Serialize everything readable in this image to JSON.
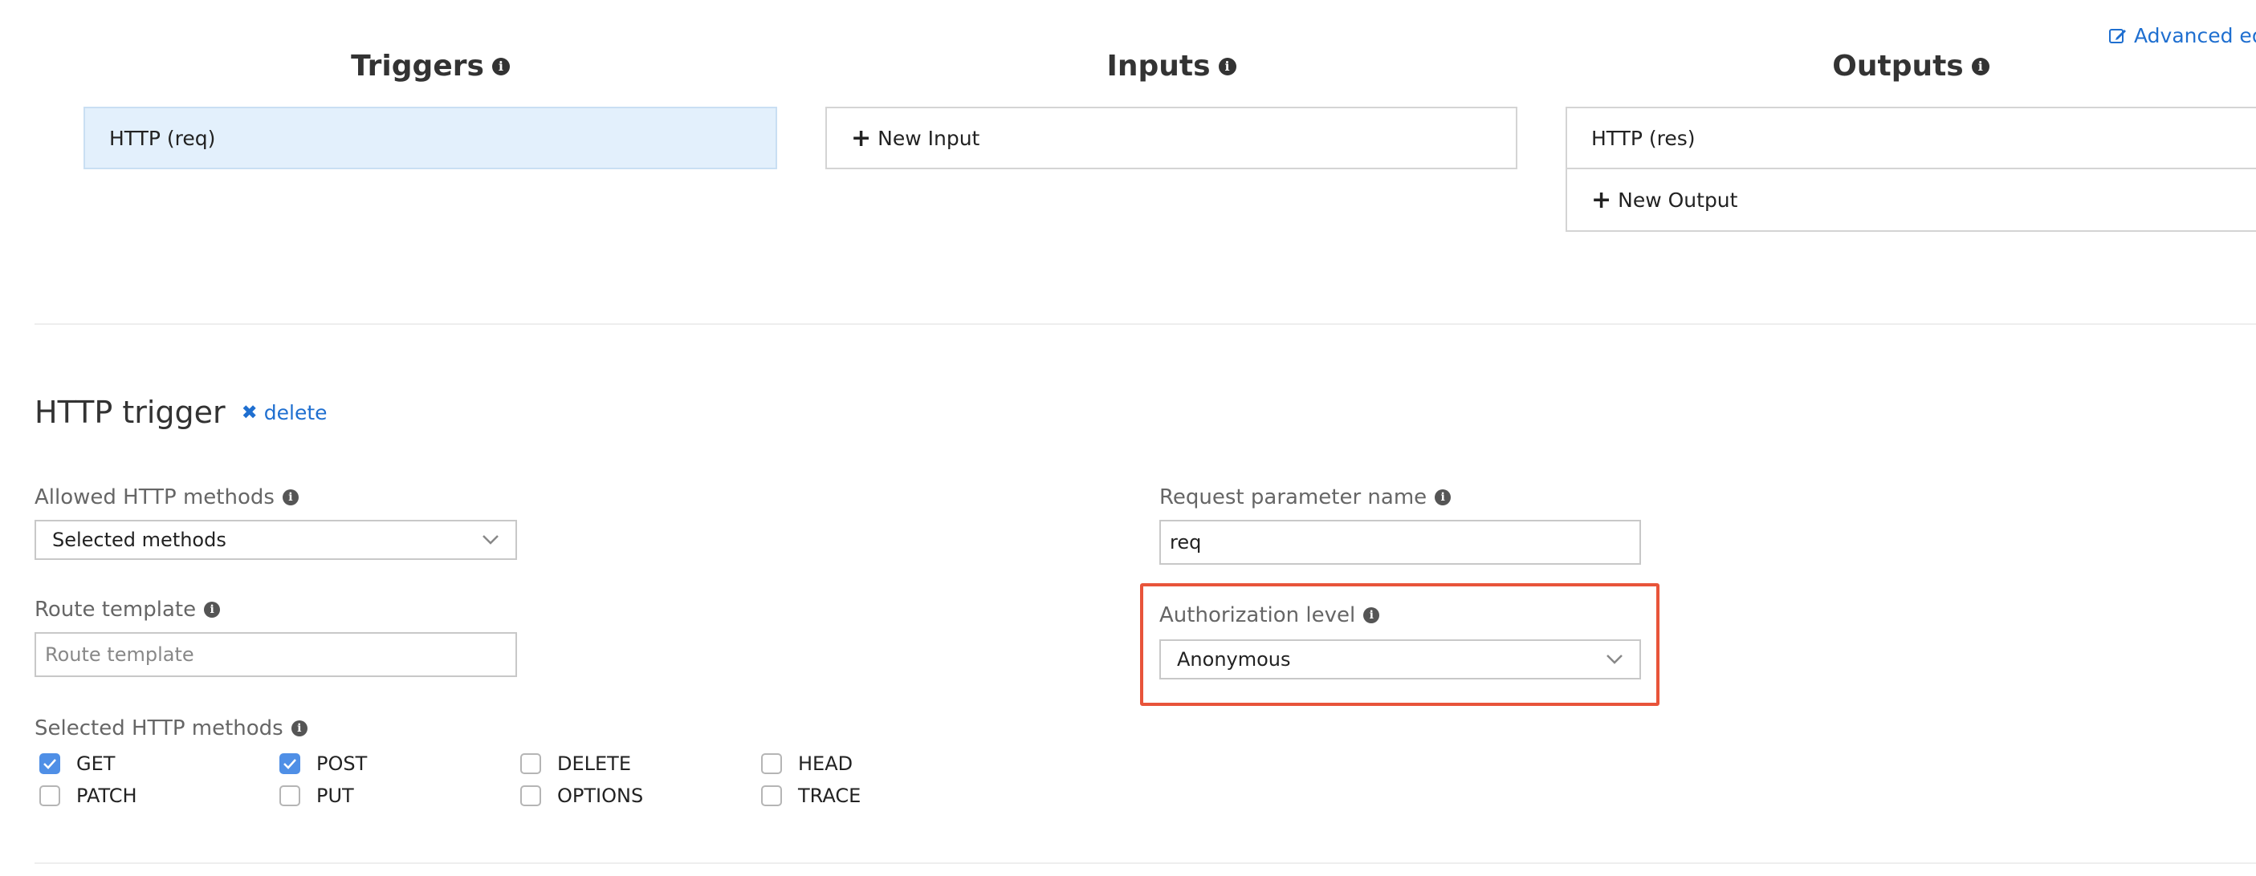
{
  "header": {
    "advanced_editor_label": "Advanced edito"
  },
  "columns": {
    "triggers": {
      "title": "Triggers",
      "items": [
        "HTTP (req)"
      ]
    },
    "inputs": {
      "title": "Inputs",
      "new_label": "New Input"
    },
    "outputs": {
      "title": "Outputs",
      "items": [
        "HTTP (res)"
      ],
      "new_label": "New Output"
    }
  },
  "trigger_panel": {
    "title": "HTTP trigger",
    "delete_label": "delete",
    "allowed_methods": {
      "label": "Allowed HTTP methods",
      "value": "Selected methods"
    },
    "route_template": {
      "label": "Route template",
      "placeholder": "Route template",
      "value": ""
    },
    "request_param": {
      "label": "Request parameter name",
      "value": "req"
    },
    "auth_level": {
      "label": "Authorization level",
      "value": "Anonymous"
    },
    "selected_methods": {
      "label": "Selected HTTP methods",
      "methods": [
        {
          "name": "GET",
          "checked": true
        },
        {
          "name": "POST",
          "checked": true
        },
        {
          "name": "DELETE",
          "checked": false
        },
        {
          "name": "HEAD",
          "checked": false
        },
        {
          "name": "PATCH",
          "checked": false
        },
        {
          "name": "PUT",
          "checked": false
        },
        {
          "name": "OPTIONS",
          "checked": false
        },
        {
          "name": "TRACE",
          "checked": false
        }
      ]
    }
  },
  "colors": {
    "accent": "#1f6fd0",
    "highlight": "#e8543a",
    "active_item": "#e3f0fc",
    "checkbox": "#4f8fe6"
  }
}
